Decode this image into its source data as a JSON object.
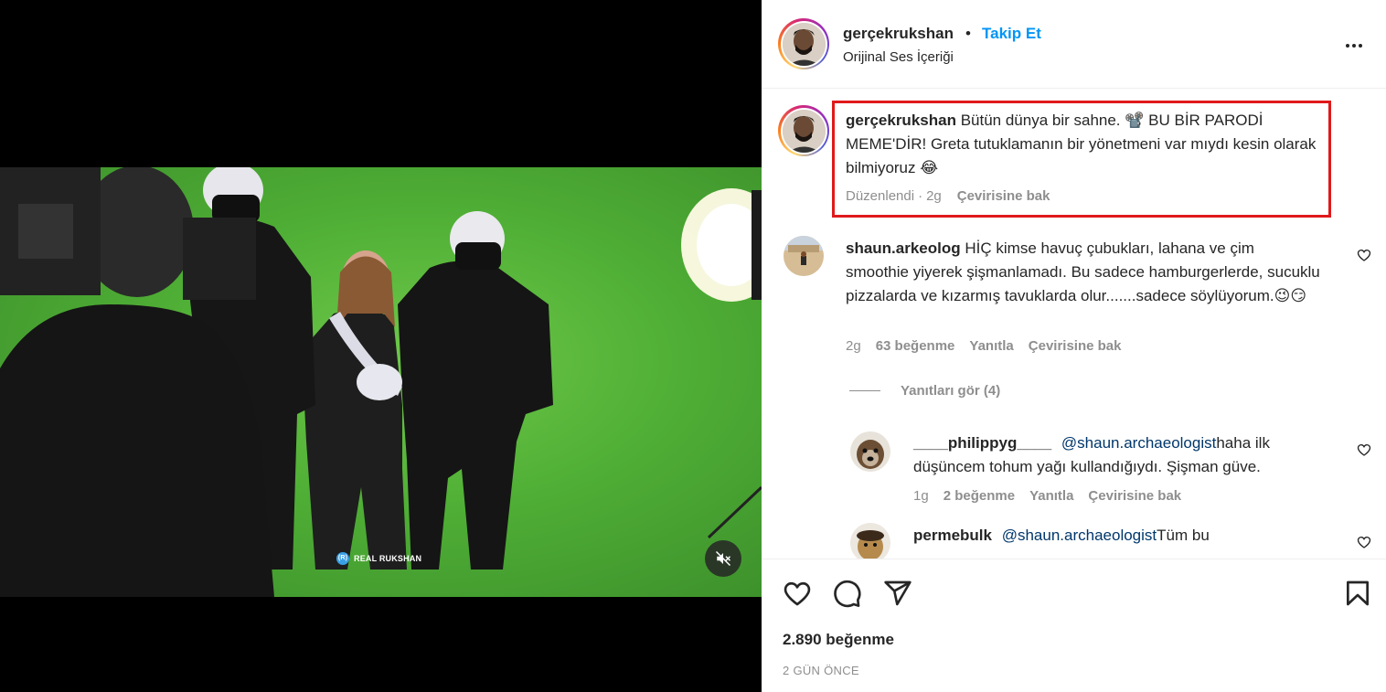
{
  "video": {
    "watermark_label": "REAL RUKSHAN",
    "watermark_badge": "(R)",
    "mute_icon": "speaker-muted-icon"
  },
  "header": {
    "username": "gerçekrukshan",
    "separator": "•",
    "follow_label": "Takip Et",
    "audio_label": "Orijinal Ses İçeriği",
    "more_icon": "more-horizontal-icon"
  },
  "caption": {
    "username": "gerçekrukshan",
    "text": "Bütün dünya bir sahne. 📽️ BU BİR PARODİ MEME'DİR! Greta tutuklamanın bir yönetmeni var mıydı kesin olarak bilmiyoruz 😂",
    "edited": "Düzenlendi",
    "dot": "·",
    "time": "2g",
    "translate": "Çevirisine bak",
    "highlight_color": "#e0191b"
  },
  "comments": [
    {
      "username": "shaun.arkeolog",
      "text": "HİÇ kimse havuç çubukları, lahana ve çim smoothie yiyerek şişmanlamadı. Bu sadece hamburgerlerde, sucuklu pizzalarda ve kızarmış tavuklarda olur.......sadece söylüyorum.😉😏",
      "time": "2g",
      "likes": "63 beğenme",
      "reply": "Yanıtla",
      "translate": "Çevirisine bak",
      "view_replies": "Yanıtları gör (4)"
    }
  ],
  "replies": [
    {
      "username": "____philippyg____",
      "mention": "@shaun.archaeologist",
      "text": "haha ilk düşüncem tohum yağı kullandığıydı. Şişman güve.",
      "time": "1g",
      "likes": "2 beğenme",
      "reply": "Yanıtla",
      "translate": "Çevirisine bak"
    },
    {
      "username": "permebulk",
      "mention": "@shaun.archaeologist",
      "text": "Tüm bu"
    }
  ],
  "actions": {
    "like_icon": "heart-icon",
    "comment_icon": "comment-bubble-icon",
    "share_icon": "paper-plane-icon",
    "save_icon": "bookmark-icon",
    "likes_count": "2.890 beğenme",
    "date": "2 GÜN ÖNCE"
  },
  "colors": {
    "accent": "#0095f6",
    "muted": "#8e8e8e",
    "text": "#262626"
  }
}
